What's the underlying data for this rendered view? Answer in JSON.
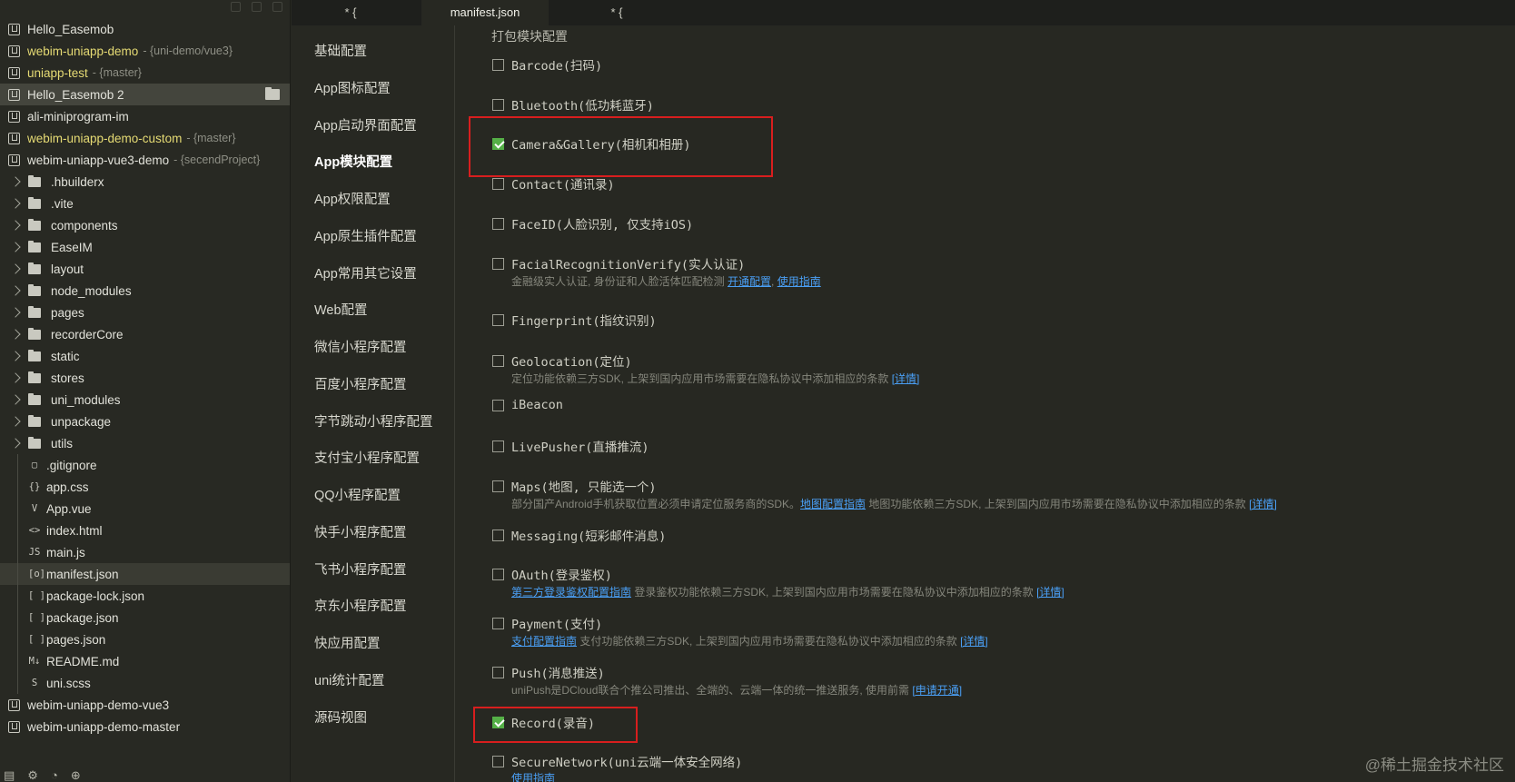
{
  "tabs": [
    {
      "label": "* {"
    },
    {
      "label": "manifest.json"
    },
    {
      "label": "* {"
    }
  ],
  "explorer": {
    "projects_top": [
      {
        "name": "Hello_Easemob",
        "branch": ""
      },
      {
        "name": "webim-uniapp-demo",
        "branch": "- {uni-demo/vue3}"
      },
      {
        "name": "uniapp-test",
        "branch": "- {master}"
      },
      {
        "name": "Hello_Easemob 2",
        "branch": ""
      },
      {
        "name": "ali-miniprogram-im",
        "branch": ""
      },
      {
        "name": "webim-uniapp-demo-custom",
        "branch": "- {master}"
      },
      {
        "name": "webim-uniapp-vue3-demo",
        "branch": "- {secendProject}"
      }
    ],
    "folders": [
      ".hbuilderx",
      ".vite",
      "components",
      "EaseIM",
      "layout",
      "node_modules",
      "pages",
      "recorderCore",
      "static",
      "stores",
      "uni_modules",
      "unpackage",
      "utils"
    ],
    "files": [
      {
        "name": ".gitignore",
        "icon": "▢"
      },
      {
        "name": "app.css",
        "icon": "{}"
      },
      {
        "name": "App.vue",
        "icon": "V"
      },
      {
        "name": "index.html",
        "icon": "<>"
      },
      {
        "name": "main.js",
        "icon": "JS"
      },
      {
        "name": "manifest.json",
        "icon": "[o]"
      },
      {
        "name": "package-lock.json",
        "icon": "[ ]"
      },
      {
        "name": "package.json",
        "icon": "[ ]"
      },
      {
        "name": "pages.json",
        "icon": "[ ]"
      },
      {
        "name": "README.md",
        "icon": "M↓"
      },
      {
        "name": "uni.scss",
        "icon": "S"
      }
    ],
    "projects_bottom": [
      {
        "name": "webim-uniapp-demo-vue3"
      },
      {
        "name": "webim-uniapp-demo-master"
      }
    ],
    "footer_icons": [
      "▤",
      "⚙",
      "◔",
      "⊕"
    ]
  },
  "settings_nav": [
    "基础配置",
    "App图标配置",
    "App启动界面配置",
    "App模块配置",
    "App权限配置",
    "App原生插件配置",
    "App常用其它设置",
    "Web配置",
    "微信小程序配置",
    "百度小程序配置",
    "字节跳动小程序配置",
    "支付宝小程序配置",
    "QQ小程序配置",
    "快手小程序配置",
    "飞书小程序配置",
    "京东小程序配置",
    "快应用配置",
    "uni统计配置",
    "源码视图"
  ],
  "content": {
    "section_title": "打包模块配置",
    "modules": [
      {
        "label": "Barcode(扫码)",
        "checked": false
      },
      {
        "label": "Bluetooth(低功耗蓝牙)",
        "checked": false
      },
      {
        "label": "Camera&Gallery(相机和相册)",
        "checked": true
      },
      {
        "label": "Contact(通讯录)",
        "checked": false
      },
      {
        "label": "FaceID(人脸识别, 仅支持iOS)",
        "checked": false
      },
      {
        "label": "FacialRecognitionVerify(实人认证)",
        "checked": false
      },
      {
        "label": "Fingerprint(指纹识别)",
        "checked": false
      },
      {
        "label": "Geolocation(定位)",
        "checked": false
      },
      {
        "label": "iBeacon",
        "checked": false
      },
      {
        "label": "LivePusher(直播推流)",
        "checked": false
      },
      {
        "label": "Maps(地图, 只能选一个)",
        "checked": false
      },
      {
        "label": "Messaging(短彩邮件消息)",
        "checked": false
      },
      {
        "label": "OAuth(登录鉴权)",
        "checked": false
      },
      {
        "label": "Payment(支付)",
        "checked": false
      },
      {
        "label": "Push(消息推送)",
        "checked": false
      },
      {
        "label": "Record(录音)",
        "checked": true
      },
      {
        "label": "SecureNetwork(uni云端一体安全网络)",
        "checked": false
      }
    ],
    "desc_facial": {
      "text": "金融级实人认证, 身份证和人脸活体匹配检测",
      "link1": "开通配置",
      "sep": ",",
      "link2": "使用指南"
    },
    "desc_geo": {
      "text": "定位功能依赖三方SDK, 上架到国内应用市场需要在隐私协议中添加相应的条款",
      "link": "[详情]"
    },
    "desc_maps": {
      "text1": "部分国产Android手机获取位置必须申请定位服务商的SDK。",
      "link1": "地图配置指南",
      "text2": "地图功能依赖三方SDK, 上架到国内应用市场需要在隐私协议中添加相应的条款",
      "link2": "[详情]"
    },
    "desc_oauth": {
      "link1": "第三方登录鉴权配置指南",
      "text": "登录鉴权功能依赖三方SDK, 上架到国内应用市场需要在隐私协议中添加相应的条款",
      "link2": "[详情]"
    },
    "desc_pay": {
      "link1": "支付配置指南",
      "text": "支付功能依赖三方SDK, 上架到国内应用市场需要在隐私协议中添加相应的条款",
      "link2": "[详情]"
    },
    "desc_push": {
      "text": "uniPush是DCloud联合个推公司推出、全端的、云端一体的统一推送服务, 使用前需",
      "link": "[申请开通]"
    },
    "desc_secure": {
      "link": "使用指南"
    }
  },
  "watermark": "@稀土掘金技术社区",
  "colors": {
    "checked": "#55b047",
    "highlight": "#d81e1e",
    "link": "#4a9ff5",
    "project_yellow": "#e6db74"
  }
}
